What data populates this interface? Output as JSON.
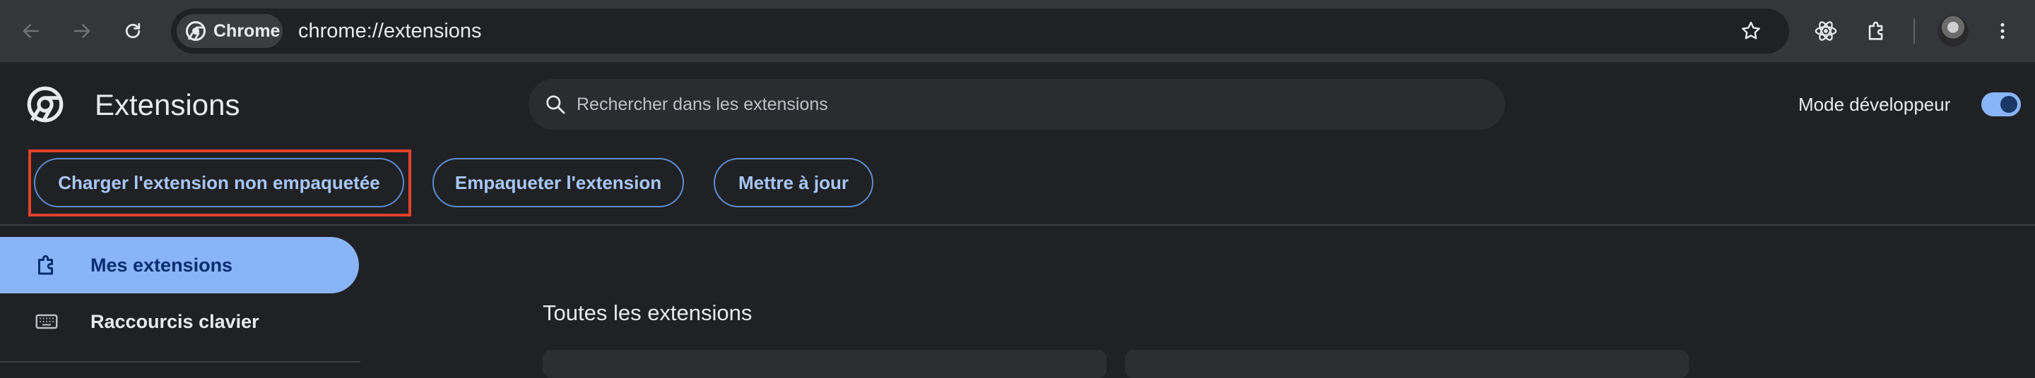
{
  "browser": {
    "chip_label": "Chrome",
    "url": "chrome://extensions",
    "icons": [
      "back-icon",
      "forward-icon",
      "reload-icon",
      "chrome-icon",
      "bookmark-star-icon",
      "react-devtools-icon",
      "extensions-puzzle-icon",
      "avatar",
      "more-vert-icon"
    ]
  },
  "header": {
    "title": "Extensions",
    "search_placeholder": "Rechercher dans les extensions",
    "dev_mode_label": "Mode développeur",
    "dev_mode_on": true
  },
  "actions": {
    "load_unpacked": "Charger l'extension non empaquetée",
    "pack": "Empaqueter l'extension",
    "update": "Mettre à jour"
  },
  "sidebar": {
    "items": [
      {
        "label": "Mes extensions",
        "icon": "extension-puzzle-icon",
        "active": true
      },
      {
        "label": "Raccourcis clavier",
        "icon": "keyboard-icon",
        "active": false
      }
    ]
  },
  "main": {
    "section_title": "Toutes les extensions"
  },
  "colors": {
    "accent": "#8ab4f8",
    "highlight_box": "#e2412d",
    "background": "#202124",
    "toolbar": "#35363a"
  }
}
